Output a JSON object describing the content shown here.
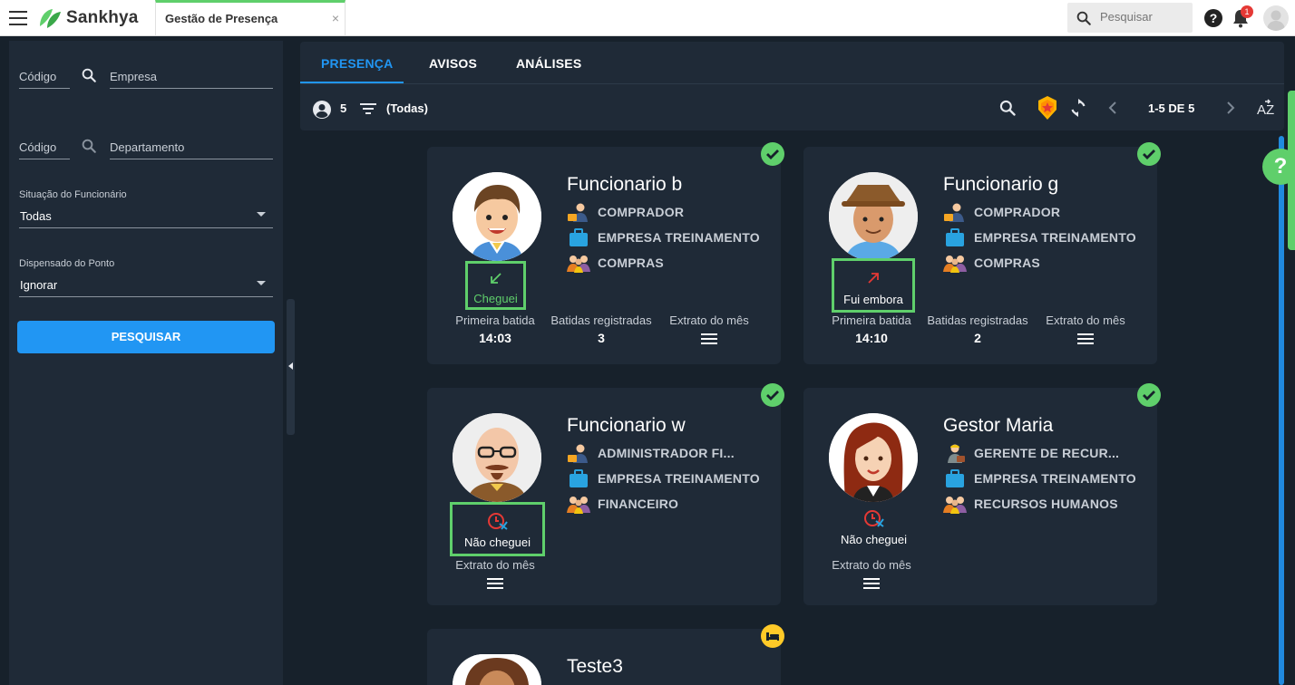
{
  "app": {
    "brand": "Sankhya",
    "tab_title": "Gestão de Presença",
    "tab_close": "×"
  },
  "topbar": {
    "search_placeholder": "Pesquisar",
    "help": "?",
    "notifications_count": "1"
  },
  "filters": {
    "empresa": {
      "code_label": "Código",
      "label": "Empresa"
    },
    "departamento": {
      "code_label": "Código",
      "label": "Departamento"
    },
    "situacao": {
      "label": "Situação do Funcionário",
      "value": "Todas"
    },
    "dispensado": {
      "label": "Dispensado do Ponto",
      "value": "Ignorar"
    },
    "search_button": "PESQUISAR"
  },
  "main": {
    "tabs": [
      {
        "label": "PRESENÇA",
        "active": true
      },
      {
        "label": "AVISOS"
      },
      {
        "label": "ANÁLISES"
      }
    ],
    "toolbar": {
      "count": "5",
      "filter": "(Todas)",
      "pagination": "1-5 DE 5"
    }
  },
  "help_bubble": "?",
  "cards": [
    {
      "name": "Funcionario b",
      "role": "COMPRADOR",
      "company": "EMPRESA TREINAMENTO",
      "department": "COMPRAS",
      "status": "Cheguei",
      "first_label": "Primeira batida",
      "first_value": "14:03",
      "count_label": "Batidas registradas",
      "count_value": "3",
      "statement_label": "Extrato do mês"
    },
    {
      "name": "Funcionario g",
      "role": "COMPRADOR",
      "company": "EMPRESA TREINAMENTO",
      "department": "COMPRAS",
      "status": "Fui embora",
      "first_label": "Primeira batida",
      "first_value": "14:10",
      "count_label": "Batidas registradas",
      "count_value": "2",
      "statement_label": "Extrato do mês"
    },
    {
      "name": "Funcionario w",
      "role": "ADMINISTRADOR FI...",
      "company": "EMPRESA TREINAMENTO",
      "department": "FINANCEIRO",
      "status": "Não cheguei",
      "statement_label": "Extrato do mês"
    },
    {
      "name": "Gestor Maria",
      "role": "GERENTE DE RECUR...",
      "company": "EMPRESA TREINAMENTO",
      "department": "RECURSOS HUMANOS",
      "status": "Não cheguei",
      "statement_label": "Extrato do mês"
    },
    {
      "name": "Teste3"
    }
  ],
  "colors": {
    "accent": "#2196f3",
    "success": "#5fcf6b",
    "panel": "#1f2a37",
    "background": "#17212b",
    "alert": "#e53935"
  }
}
